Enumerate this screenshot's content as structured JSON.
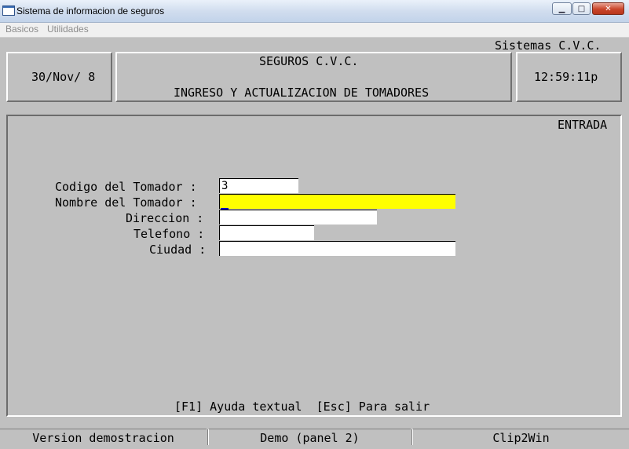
{
  "window": {
    "title": "Sistema de informacion de seguros",
    "minimize_glyph": "▁",
    "maximize_glyph": "□",
    "close_glyph": "✕"
  },
  "menu": {
    "items": [
      "Basicos",
      "Utilidades"
    ]
  },
  "header": {
    "company": "Sistemas C.V.C.",
    "date": "30/Nov/ 8",
    "app_title": "SEGUROS C.V.C.",
    "subtitle": "INGRESO Y ACTUALIZACION DE TOMADORES",
    "time": "12:59:11p"
  },
  "form": {
    "mode": "ENTRADA",
    "fields": [
      {
        "label": "Codigo del Tomador :",
        "value": "3"
      },
      {
        "label": "Nombre del Tomador :",
        "value": ""
      },
      {
        "label": "Direccion :",
        "value": ""
      },
      {
        "label": "Telefono :",
        "value": ""
      },
      {
        "label": "Ciudad :",
        "value": ""
      }
    ],
    "footer_help": "[F1] Ayuda textual  [Esc] Para salir"
  },
  "statusbar": {
    "left": "Version demostracion",
    "middle": "Demo (panel 2)",
    "right": "Clip2Win"
  },
  "colors": {
    "active_field": "#ffff00",
    "background": "#c0c0c0"
  }
}
